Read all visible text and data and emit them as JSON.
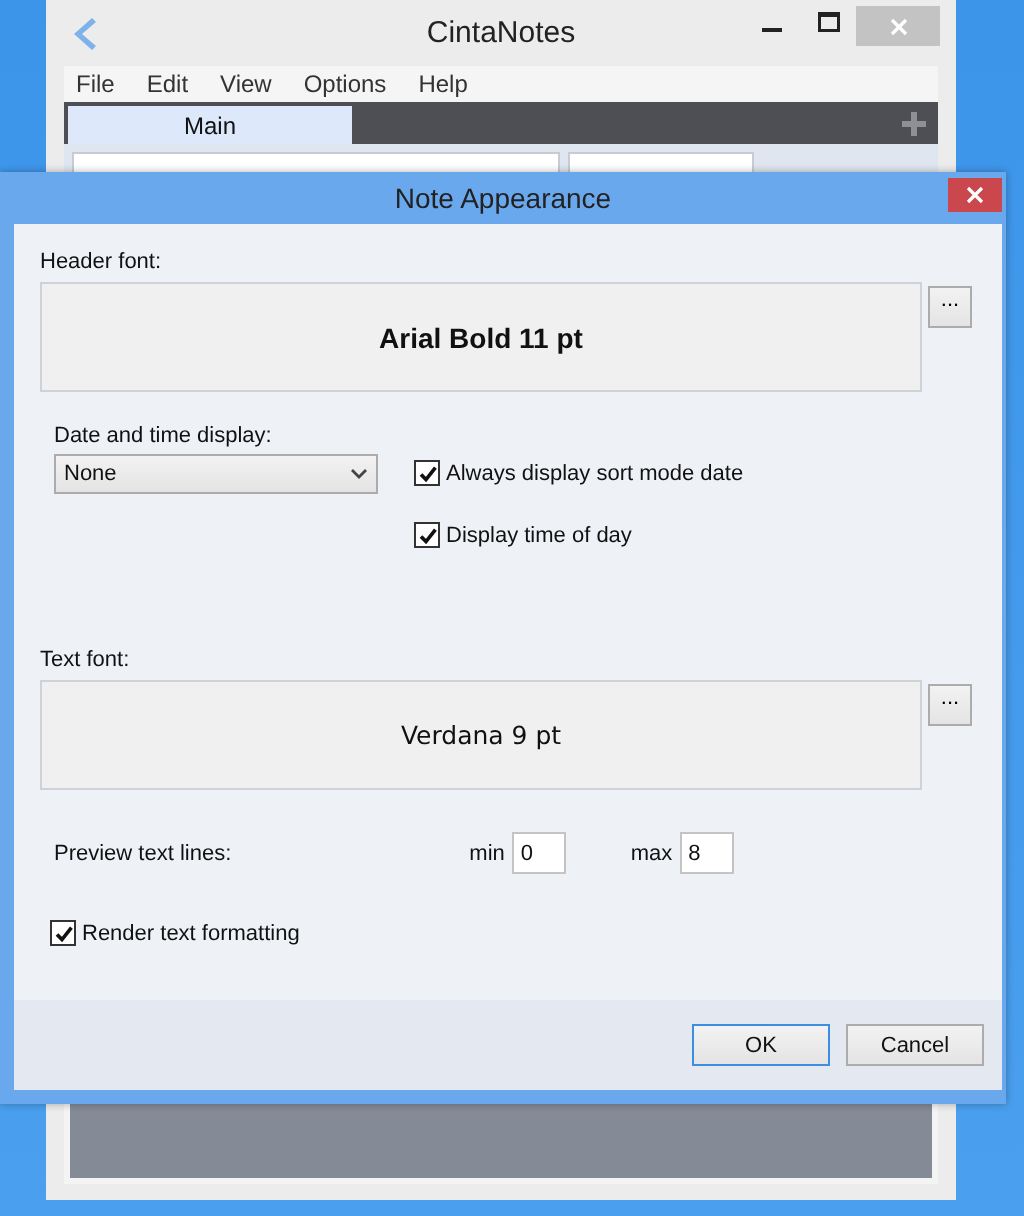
{
  "main_window": {
    "title": "CintaNotes",
    "menu": [
      "File",
      "Edit",
      "View",
      "Options",
      "Help"
    ],
    "tabs": [
      {
        "label": "Main",
        "selected": true
      }
    ]
  },
  "dialog": {
    "title": "Note Appearance",
    "header_font": {
      "label": "Header font:",
      "preview": "Arial Bold 11 pt",
      "button": "..."
    },
    "date_time": {
      "label": "Date and time display:",
      "value": "None"
    },
    "date_options": [
      {
        "label": "Always display sort mode date",
        "checked": true
      },
      {
        "label": "Display time of day",
        "checked": true
      }
    ],
    "text_font": {
      "label": "Text font:",
      "preview": "Verdana 9 pt",
      "button": "..."
    },
    "preview_lines": {
      "label": "Preview text lines:",
      "min_label": "min",
      "min": "0",
      "max_label": "max",
      "max": "8"
    },
    "render_formatting": {
      "label": "Render text formatting",
      "checked": true
    },
    "buttons": [
      {
        "label": "OK",
        "default": true
      },
      {
        "label": "Cancel",
        "default": false
      }
    ]
  }
}
